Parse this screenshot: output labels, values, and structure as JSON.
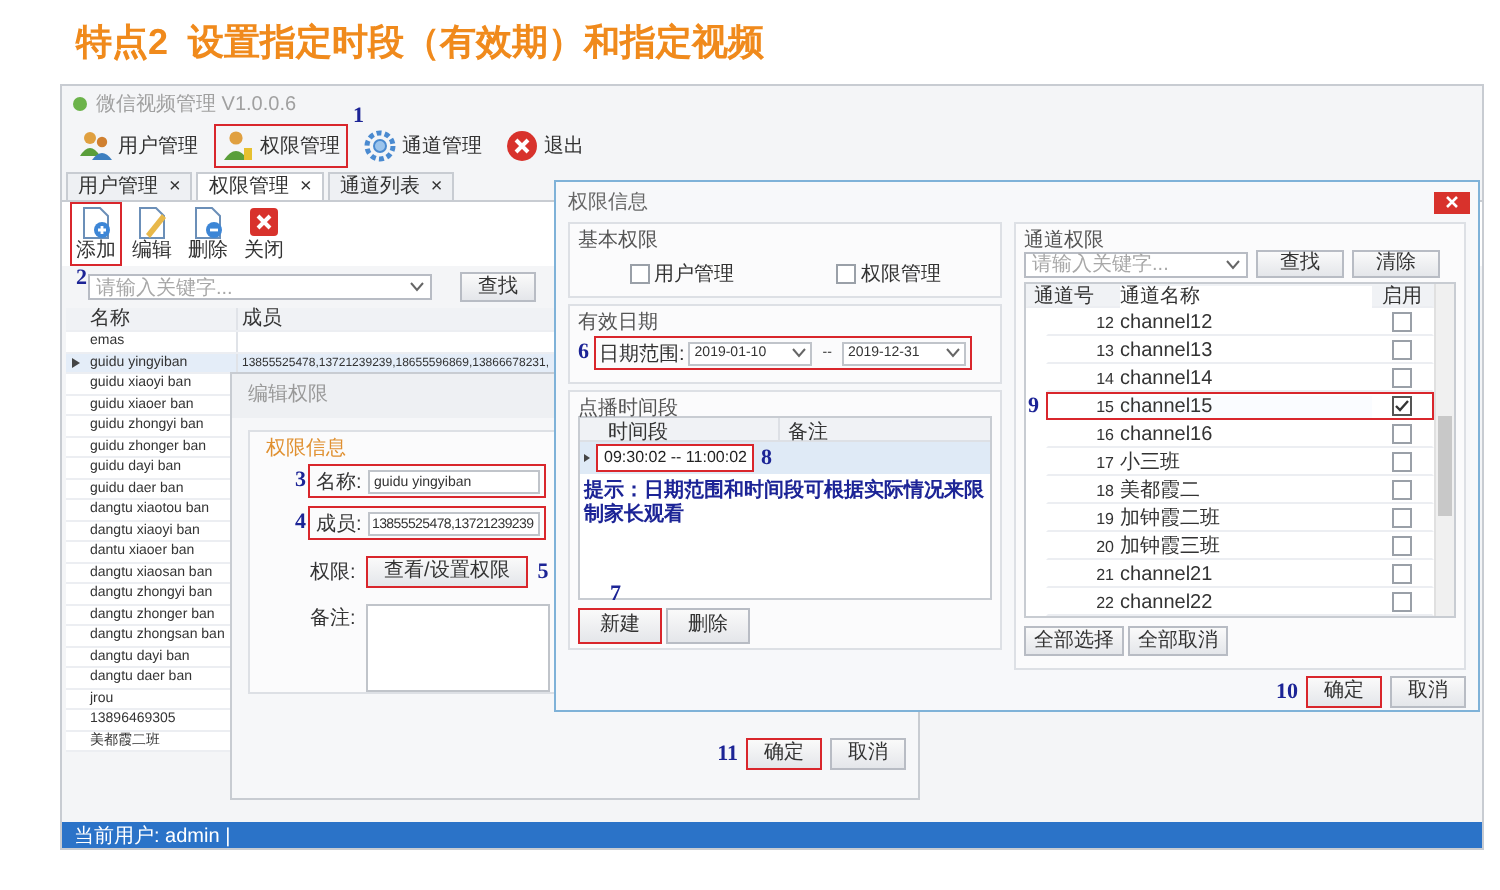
{
  "headline": "特点2  设置指定时段（有效期）和指定视频",
  "app": {
    "title": "微信视频管理 V1.0.0.6",
    "toolbar": [
      {
        "label": "用户管理"
      },
      {
        "label": "权限管理",
        "callout": "1"
      },
      {
        "label": "通道管理"
      },
      {
        "label": "退出"
      }
    ],
    "tabs": [
      {
        "label": "用户管理",
        "close": "×",
        "selected": false
      },
      {
        "label": "权限管理",
        "close": "×",
        "selected": true
      },
      {
        "label": "通道列表",
        "close": "×",
        "selected": false
      }
    ],
    "actions": [
      {
        "label": "添加",
        "callout": "2"
      },
      {
        "label": "编辑"
      },
      {
        "label": "删除"
      },
      {
        "label": "关闭"
      }
    ],
    "search": {
      "placeholder": "请输入关键字...",
      "button": "查找"
    },
    "table": {
      "columns": [
        "名称",
        "成员"
      ],
      "rows": [
        {
          "name": "emas",
          "selected": false
        },
        {
          "name": "guidu yingyiban",
          "members": "13855525478,13721239239,18655596869,13866678231,",
          "selected": true
        },
        {
          "name": "guidu xiaoyi ban",
          "selected": false
        },
        {
          "name": "guidu xiaoer ban",
          "selected": false
        },
        {
          "name": "guidu zhongyi ban",
          "selected": false
        },
        {
          "name": "guidu zhonger ban",
          "selected": false
        },
        {
          "name": "guidu dayi ban",
          "selected": false
        },
        {
          "name": "guidu daer ban",
          "selected": false
        },
        {
          "name": "dangtu xiaotou ban",
          "selected": false
        },
        {
          "name": "dangtu xiaoyi ban",
          "selected": false
        },
        {
          "name": "dantu xiaoer ban",
          "selected": false
        },
        {
          "name": "dangtu xiaosan ban",
          "selected": false
        },
        {
          "name": "dangtu zhongyi ban",
          "selected": false
        },
        {
          "name": "dangtu zhonger ban",
          "selected": false
        },
        {
          "name": "dangtu zhongsan ban",
          "selected": false
        },
        {
          "name": "dangtu dayi ban",
          "selected": false
        },
        {
          "name": "dangtu  daer ban",
          "selected": false
        },
        {
          "name": "jrou",
          "selected": false
        },
        {
          "name": "13896469305",
          "selected": false
        },
        {
          "name": "美都霞二班",
          "selected": false
        }
      ]
    },
    "status_bar": "当前用户: admin |"
  },
  "edit_dialog": {
    "title": "编辑权限",
    "group": "权限信息",
    "name": {
      "label": "名称:",
      "value": "guidu yingyiban",
      "callout": "3"
    },
    "members": {
      "label": "成员:",
      "value": "13855525478,13721239239",
      "callout": "4"
    },
    "permission": {
      "label": "权限:",
      "button": "查看/设置权限",
      "callout": "5"
    },
    "note": {
      "label": "备注:"
    },
    "ok": {
      "label": "确定",
      "callout": "11"
    },
    "cancel": {
      "label": "取消"
    }
  },
  "perm_dialog": {
    "title": "权限信息",
    "basic": {
      "title": "基本权限",
      "options": [
        {
          "label": "用户管理",
          "checked": false
        },
        {
          "label": "权限管理",
          "checked": false
        }
      ]
    },
    "validity": {
      "title": "有效日期",
      "label": "日期范围:",
      "from": "2019-01-10",
      "separator": "--",
      "to": "2019-12-31",
      "callout": "6"
    },
    "periods": {
      "title": "点播时间段",
      "columns": [
        "时间段",
        "备注"
      ],
      "rows": [
        {
          "period": "09:30:02 -- 11:00:02",
          "callout": "8"
        }
      ],
      "hint": "提示：日期范围和时间段可根据实际情况来限制家长观看",
      "buttons": [
        {
          "label": "新建",
          "callout": "7"
        },
        {
          "label": "删除"
        }
      ]
    },
    "channels": {
      "title": "通道权限",
      "placeholder": "请输入关键字...",
      "buttons": [
        "查找",
        "清除"
      ],
      "columns": [
        "通道号",
        "通道名称",
        "启用"
      ],
      "rows": [
        {
          "no": "12",
          "name": "channel12",
          "enabled": false
        },
        {
          "no": "13",
          "name": "channel13",
          "enabled": false
        },
        {
          "no": "14",
          "name": "channel14",
          "enabled": false
        },
        {
          "no": "15",
          "name": "channel15",
          "enabled": true,
          "callout": "9"
        },
        {
          "no": "16",
          "name": "channel16",
          "enabled": false
        },
        {
          "no": "17",
          "name": "小三班",
          "enabled": false
        },
        {
          "no": "18",
          "name": "美都霞二",
          "enabled": false
        },
        {
          "no": "19",
          "name": "加钟霞二班",
          "enabled": false
        },
        {
          "no": "20",
          "name": "加钟霞三班",
          "enabled": false
        },
        {
          "no": "21",
          "name": "channel21",
          "enabled": false
        },
        {
          "no": "22",
          "name": "channel22",
          "enabled": false
        }
      ],
      "footer_buttons": [
        "全部选择",
        "全部取消"
      ]
    },
    "ok": {
      "label": "确定",
      "callout": "10"
    },
    "cancel": {
      "label": "取消"
    }
  }
}
